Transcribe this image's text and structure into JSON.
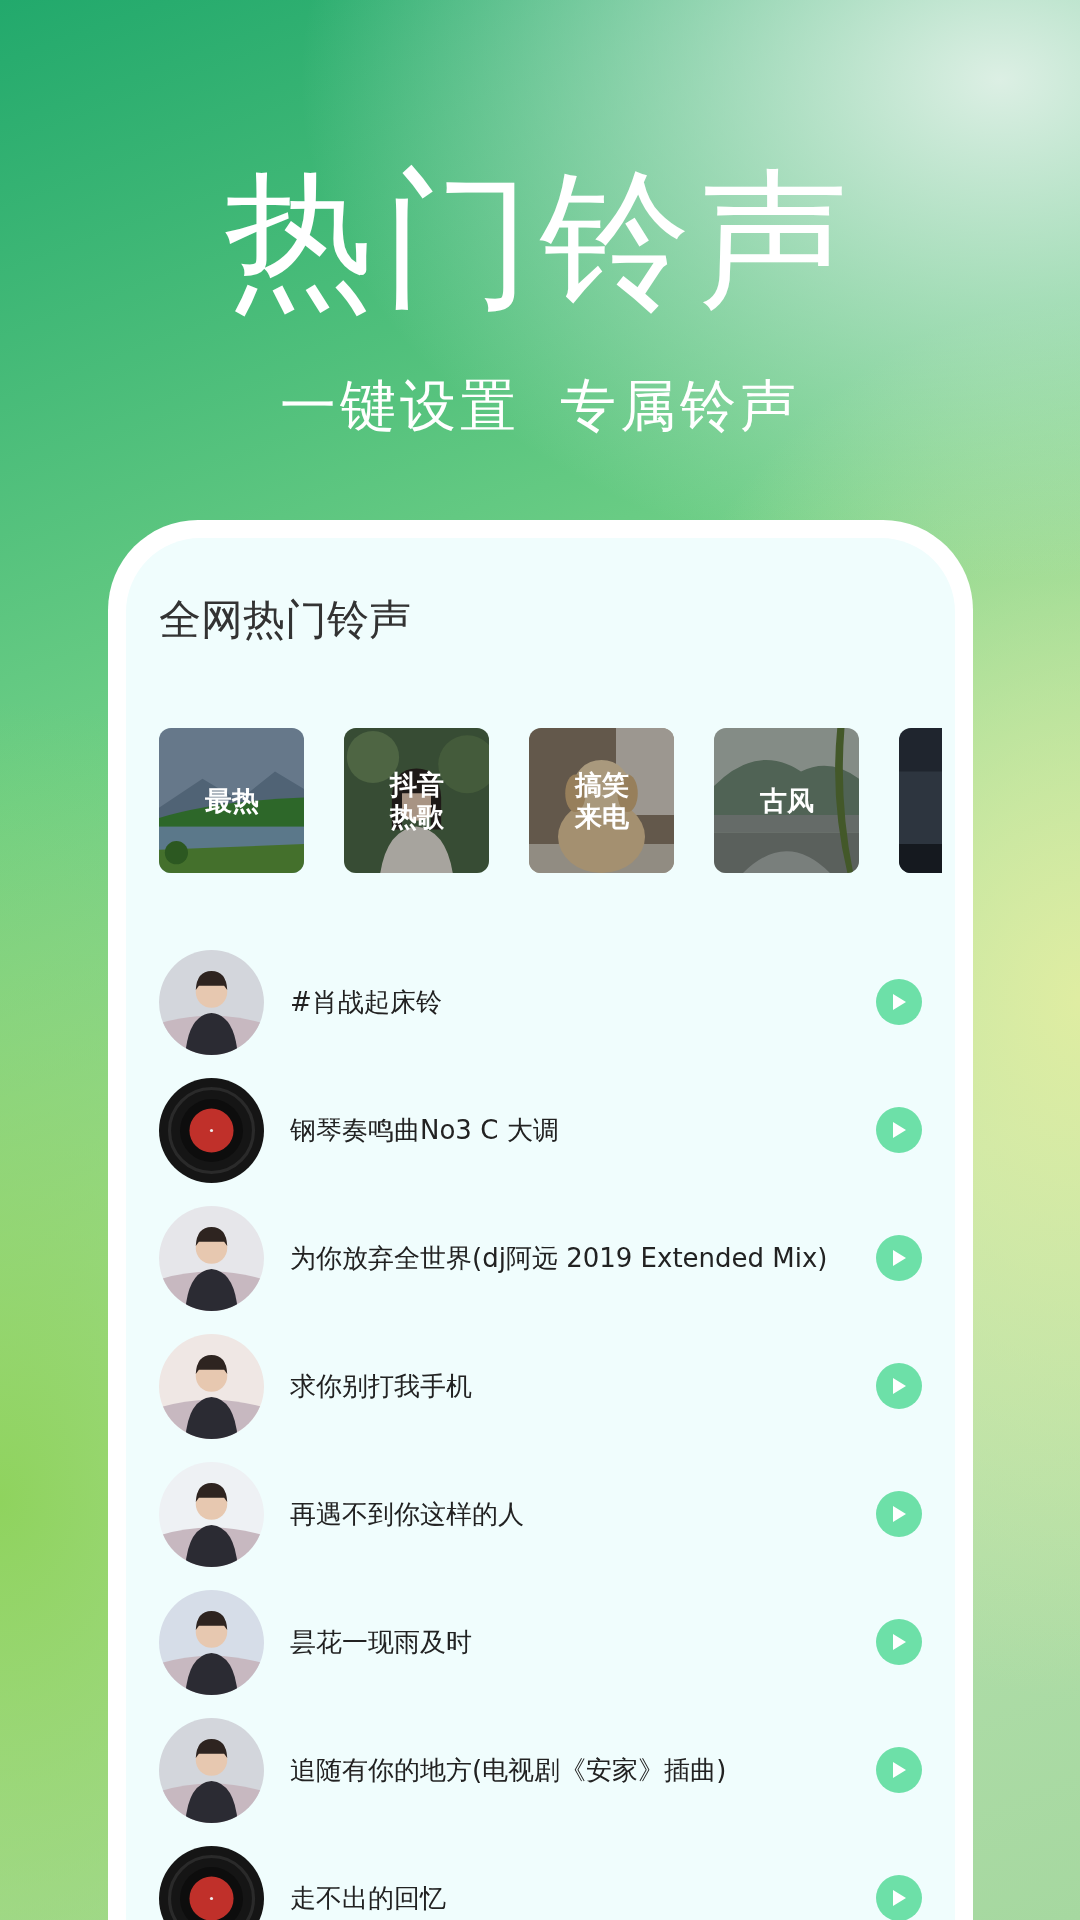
{
  "headline": "热门铃声",
  "taglines": [
    "一键设置",
    "专属铃声"
  ],
  "screen": {
    "title": "全网热门铃声",
    "categories": [
      {
        "label": "最热",
        "kind": "picture"
      },
      {
        "label": "抖音热歌",
        "kind": "picture"
      },
      {
        "label": "搞笑来电",
        "kind": "picture"
      },
      {
        "label": "古风",
        "kind": "picture"
      },
      {
        "kind": "picture"
      }
    ],
    "ringtones": [
      {
        "title": "#肖战起床铃"
      },
      {
        "title": "钢琴奏鸣曲No3 C 大调",
        "kind": "vinyl"
      },
      {
        "title": "为你放弃全世界(dj阿远 2019 Extended Mix)"
      },
      {
        "title": "求你别打我手机"
      },
      {
        "title": "再遇不到你这样的人"
      },
      {
        "title": "昙花一现雨及时"
      },
      {
        "title": "追随有你的地方(电视剧《安家》插曲)"
      },
      {
        "title": "走不出的回忆",
        "kind": "vinyl"
      }
    ]
  }
}
